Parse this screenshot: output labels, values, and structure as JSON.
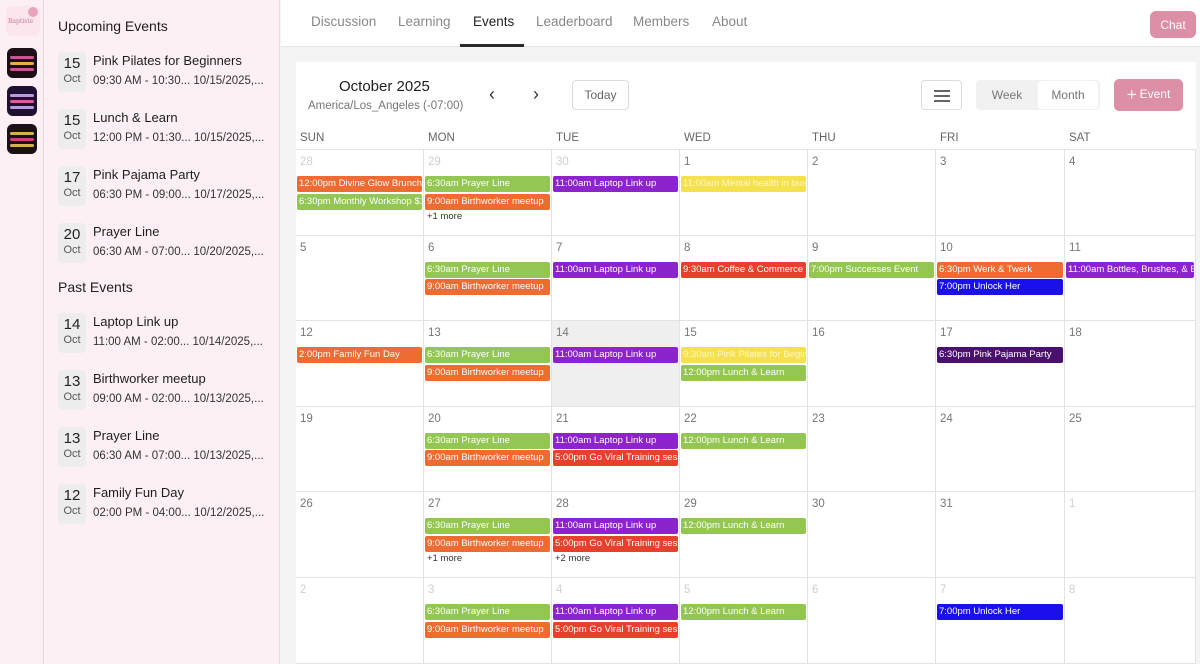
{
  "nav": {
    "tabs": [
      {
        "label": "Discussion"
      },
      {
        "label": "Learning"
      },
      {
        "label": "Events"
      },
      {
        "label": "Leaderboard"
      },
      {
        "label": "Members"
      },
      {
        "label": "About"
      }
    ],
    "active_tab": "Events",
    "chat_label": "Chat"
  },
  "rail": {
    "logo_text": "Baptiste"
  },
  "panel": {
    "upcoming_heading": "Upcoming Events",
    "past_heading": "Past Events",
    "upcoming": [
      {
        "day": "15",
        "month": "Oct",
        "title": "Pink Pilates for Beginners",
        "meta": "09:30 AM - 10:30... 10/15/2025,..."
      },
      {
        "day": "15",
        "month": "Oct",
        "title": "Lunch & Learn",
        "meta": "12:00 PM - 01:30... 10/15/2025,..."
      },
      {
        "day": "17",
        "month": "Oct",
        "title": "Pink Pajama Party",
        "meta": "06:30 PM - 09:00... 10/17/2025,..."
      },
      {
        "day": "20",
        "month": "Oct",
        "title": "Prayer Line",
        "meta": "06:30 AM - 07:00... 10/20/2025,..."
      }
    ],
    "past": [
      {
        "day": "14",
        "month": "Oct",
        "title": "Laptop Link up",
        "meta": "11:00 AM - 02:00... 10/14/2025,..."
      },
      {
        "day": "13",
        "month": "Oct",
        "title": "Birthworker meetup",
        "meta": "09:00 AM - 02:00... 10/13/2025,..."
      },
      {
        "day": "13",
        "month": "Oct",
        "title": "Prayer Line",
        "meta": "06:30 AM - 07:00... 10/13/2025,..."
      },
      {
        "day": "12",
        "month": "Oct",
        "title": "Family Fun Day",
        "meta": "02:00 PM - 04:00... 10/12/2025,..."
      }
    ]
  },
  "calendar": {
    "title": "October 2025",
    "timezone": "America/Los_Angeles (-07:00)",
    "prev_icon": "chevron-left-icon",
    "next_icon": "chevron-right-icon",
    "today_label": "Today",
    "list_icon": "list-icon",
    "week_label": "Week",
    "month_label": "Month",
    "add_event_label": "Event",
    "add_icon": "plus-icon",
    "weekdays": [
      "SUN",
      "MON",
      "TUE",
      "WED",
      "THU",
      "FRI",
      "SAT"
    ],
    "colors": {
      "orange": "#ee6b32",
      "green": "#93c653",
      "purple": "#8d22cf",
      "yellow": "#f5e04e",
      "red": "#e8402c",
      "blue": "#1a10ee",
      "darkpurple": "#4a1070",
      "accent": "#dd8fa6"
    },
    "weeks": [
      [
        {
          "n": "28",
          "dim": true,
          "events": [
            {
              "t": "12:00pm Divine Glow Brunch",
              "c": "orange"
            },
            {
              "t": "6:30pm Monthly Workshop $1",
              "c": "green"
            }
          ]
        },
        {
          "n": "29",
          "dim": true,
          "events": [
            {
              "t": "6:30am Prayer Line",
              "c": "green"
            },
            {
              "t": "9:00am Birthworker meetup",
              "c": "orange"
            }
          ],
          "more": "+1 more"
        },
        {
          "n": "30",
          "dim": true,
          "events": [
            {
              "t": "11:00am Laptop Link up",
              "c": "purple"
            }
          ]
        },
        {
          "n": "1",
          "events": [
            {
              "t": "11:00am Mental health in bus",
              "c": "yellow"
            }
          ]
        },
        {
          "n": "2",
          "events": []
        },
        {
          "n": "3",
          "events": []
        },
        {
          "n": "4",
          "events": []
        }
      ],
      [
        {
          "n": "5",
          "events": []
        },
        {
          "n": "6",
          "events": [
            {
              "t": "6:30am Prayer Line",
              "c": "green"
            },
            {
              "t": "9:00am Birthworker meetup",
              "c": "orange"
            }
          ]
        },
        {
          "n": "7",
          "events": [
            {
              "t": "11:00am Laptop Link up",
              "c": "purple"
            }
          ]
        },
        {
          "n": "8",
          "events": [
            {
              "t": "9:30am Coffee & Commerce",
              "c": "red"
            }
          ]
        },
        {
          "n": "9",
          "events": [
            {
              "t": "7:00pm Successes Event",
              "c": "green"
            }
          ]
        },
        {
          "n": "10",
          "events": [
            {
              "t": "6:30pm Werk & Twerk",
              "c": "orange"
            },
            {
              "t": "7:00pm Unlock Her",
              "c": "blue"
            }
          ]
        },
        {
          "n": "11",
          "events": [
            {
              "t": "11:00am Bottles, Brushes, & B",
              "c": "purple"
            }
          ]
        }
      ],
      [
        {
          "n": "12",
          "events": [
            {
              "t": "2:00pm Family Fun Day",
              "c": "orange"
            }
          ]
        },
        {
          "n": "13",
          "events": [
            {
              "t": "6:30am Prayer Line",
              "c": "green"
            },
            {
              "t": "9:00am Birthworker meetup",
              "c": "orange"
            }
          ]
        },
        {
          "n": "14",
          "today": true,
          "events": [
            {
              "t": "11:00am Laptop Link up",
              "c": "purple"
            }
          ]
        },
        {
          "n": "15",
          "events": [
            {
              "t": "9:30am Pink Pilates for Begin",
              "c": "yellow"
            },
            {
              "t": "12:00pm Lunch & Learn",
              "c": "green"
            }
          ]
        },
        {
          "n": "16",
          "events": []
        },
        {
          "n": "17",
          "events": [
            {
              "t": "6:30pm Pink Pajama Party",
              "c": "darkpurple"
            }
          ]
        },
        {
          "n": "18",
          "events": []
        }
      ],
      [
        {
          "n": "19",
          "events": []
        },
        {
          "n": "20",
          "events": [
            {
              "t": "6:30am Prayer Line",
              "c": "green"
            },
            {
              "t": "9:00am Birthworker meetup",
              "c": "orange"
            }
          ]
        },
        {
          "n": "21",
          "events": [
            {
              "t": "11:00am Laptop Link up",
              "c": "purple"
            },
            {
              "t": "5:00pm Go Viral Training sess",
              "c": "red"
            }
          ]
        },
        {
          "n": "22",
          "events": [
            {
              "t": "12:00pm Lunch & Learn",
              "c": "green"
            }
          ]
        },
        {
          "n": "23",
          "events": []
        },
        {
          "n": "24",
          "events": []
        },
        {
          "n": "25",
          "events": []
        }
      ],
      [
        {
          "n": "26",
          "events": []
        },
        {
          "n": "27",
          "events": [
            {
              "t": "6:30am Prayer Line",
              "c": "green"
            },
            {
              "t": "9:00am Birthworker meetup",
              "c": "orange"
            }
          ],
          "more": "+1 more"
        },
        {
          "n": "28",
          "events": [
            {
              "t": "11:00am Laptop Link up",
              "c": "purple"
            },
            {
              "t": "5:00pm Go Viral Training sess",
              "c": "red"
            }
          ],
          "more": "+2 more"
        },
        {
          "n": "29",
          "events": [
            {
              "t": "12:00pm Lunch & Learn",
              "c": "green"
            }
          ]
        },
        {
          "n": "30",
          "events": []
        },
        {
          "n": "31",
          "events": []
        },
        {
          "n": "1",
          "dim": true,
          "events": []
        }
      ],
      [
        {
          "n": "2",
          "dim": true,
          "events": []
        },
        {
          "n": "3",
          "dim": true,
          "events": [
            {
              "t": "6:30am Prayer Line",
              "c": "green"
            },
            {
              "t": "9:00am Birthworker meetup",
              "c": "orange"
            }
          ]
        },
        {
          "n": "4",
          "dim": true,
          "events": [
            {
              "t": "11:00am Laptop Link up",
              "c": "purple"
            },
            {
              "t": "5:00pm Go Viral Training sess",
              "c": "red"
            }
          ]
        },
        {
          "n": "5",
          "dim": true,
          "events": [
            {
              "t": "12:00pm Lunch & Learn",
              "c": "green"
            }
          ]
        },
        {
          "n": "6",
          "dim": true,
          "events": []
        },
        {
          "n": "7",
          "dim": true,
          "events": [
            {
              "t": "7:00pm Unlock Her",
              "c": "blue"
            }
          ]
        },
        {
          "n": "8",
          "dim": true,
          "events": []
        }
      ]
    ]
  }
}
